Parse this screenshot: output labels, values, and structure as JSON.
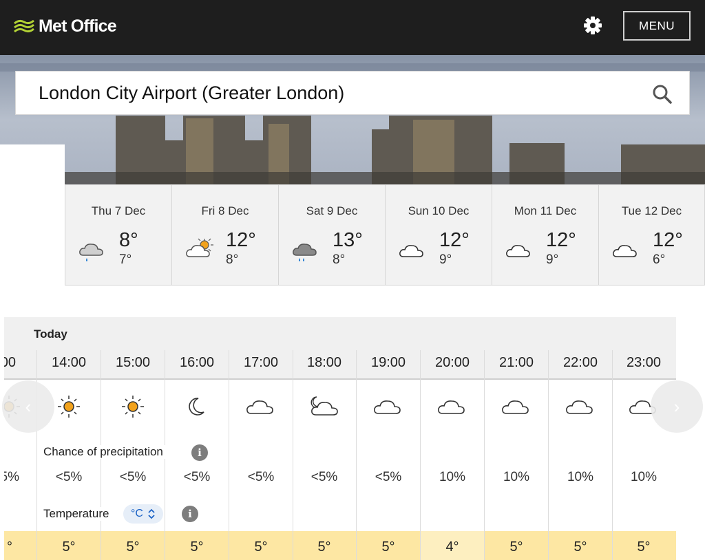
{
  "header": {
    "brand": "Met Office",
    "settings_icon": "gear-icon",
    "menu_label": "MENU"
  },
  "search": {
    "value": "London City Airport (Greater London)",
    "icon": "search-icon"
  },
  "days": [
    {
      "date": "Thu 7 Dec",
      "high": "8°",
      "low": "7°",
      "icon": "light-rain-icon"
    },
    {
      "date": "Fri 8 Dec",
      "high": "12°",
      "low": "8°",
      "icon": "sunny-intervals-icon"
    },
    {
      "date": "Sat 9 Dec",
      "high": "13°",
      "low": "8°",
      "icon": "heavy-rain-icon"
    },
    {
      "date": "Sun 10 Dec",
      "high": "12°",
      "low": "9°",
      "icon": "cloudy-icon"
    },
    {
      "date": "Mon 11 Dec",
      "high": "12°",
      "low": "9°",
      "icon": "cloudy-icon"
    },
    {
      "date": "Tue 12 Dec",
      "high": "12°",
      "low": "6°",
      "icon": "cloudy-icon"
    }
  ],
  "hourly": {
    "day_label": "Today",
    "precip_label": "Chance of precipitation",
    "temp_label": "Temperature",
    "unit": "°C",
    "columns": [
      {
        "time": ":00",
        "icon": "sunny-icon",
        "precip": "5%",
        "temp": "°"
      },
      {
        "time": "14:00",
        "icon": "sunny-icon",
        "precip": "<5%",
        "temp": "5°"
      },
      {
        "time": "15:00",
        "icon": "sunny-icon",
        "precip": "<5%",
        "temp": "5°"
      },
      {
        "time": "16:00",
        "icon": "clear-night-icon",
        "precip": "<5%",
        "temp": "5°"
      },
      {
        "time": "17:00",
        "icon": "cloudy-icon",
        "precip": "<5%",
        "temp": "5°"
      },
      {
        "time": "18:00",
        "icon": "partly-cloudy-night-icon",
        "precip": "<5%",
        "temp": "5°"
      },
      {
        "time": "19:00",
        "icon": "cloudy-icon",
        "precip": "<5%",
        "temp": "5°"
      },
      {
        "time": "20:00",
        "icon": "cloudy-icon",
        "precip": "10%",
        "temp": "4°"
      },
      {
        "time": "21:00",
        "icon": "cloudy-icon",
        "precip": "10%",
        "temp": "5°"
      },
      {
        "time": "22:00",
        "icon": "cloudy-icon",
        "precip": "10%",
        "temp": "5°"
      },
      {
        "time": "23:00",
        "icon": "cloudy-icon",
        "precip": "10%",
        "temp": "5°"
      }
    ]
  },
  "colors": {
    "header_bg": "#1e1e1e",
    "logo_green": "#b2d235",
    "sun": "#f2a21b",
    "temp_warm": "#fde7a3",
    "toggle_blue": "#1c63c6"
  }
}
